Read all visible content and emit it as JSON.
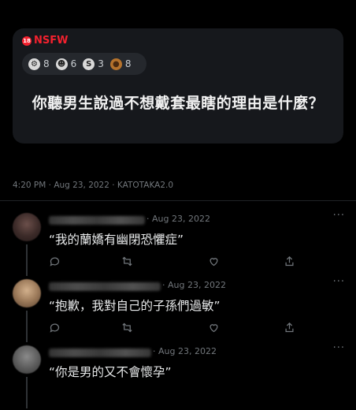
{
  "post": {
    "tag_badge": "18",
    "tag": "NSFW",
    "reactions": [
      {
        "icon": "grimace-icon",
        "glyph": "⚙",
        "count": "8"
      },
      {
        "icon": "cool-icon",
        "glyph": "☻",
        "count": "6"
      },
      {
        "icon": "swirl-icon",
        "glyph": "S",
        "count": "3"
      },
      {
        "icon": "poop-icon",
        "glyph": "●",
        "count": "8"
      }
    ],
    "title": "你聽男生說過不想戴套最瞎的理由是什麼？"
  },
  "meta": "4:20 PM · Aug 23, 2022 · KATOTAKA2.0",
  "replies": [
    {
      "date": "· Aug 23, 2022",
      "text": "“我的蘭嬌有幽閉恐懼症”",
      "more": "···"
    },
    {
      "date": "· Aug 23, 2022",
      "text": "“抱歉，我對自己的子孫們過敏”",
      "more": "···"
    },
    {
      "date": "· Aug 23, 2022",
      "text": "“你是男的又不會懷孕”",
      "more": "···"
    }
  ]
}
